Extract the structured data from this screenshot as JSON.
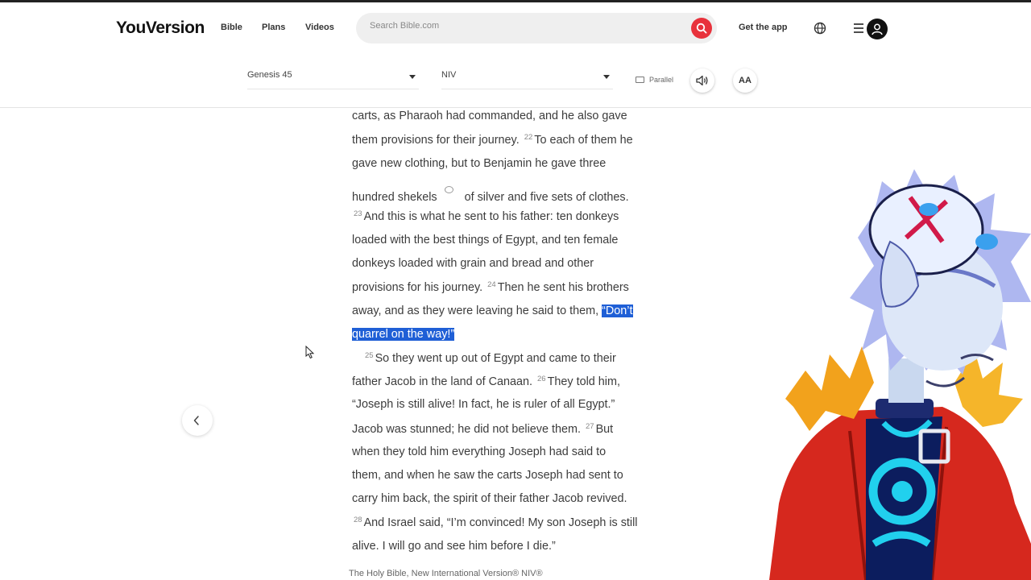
{
  "nav": {
    "logo": "YouVersion",
    "links": [
      "Bible",
      "Plans",
      "Videos"
    ],
    "search_placeholder": "Search Bible.com",
    "get_app": "Get the app"
  },
  "toolbar": {
    "book_select": "Genesis 45",
    "version_select": "NIV",
    "parallel": "Parallel",
    "font_button": "AA"
  },
  "passage": {
    "lines": [
      {
        "parts": [
          {
            "t": "carts, as Pharaoh had commanded, and he also gave"
          }
        ]
      },
      {
        "parts": [
          {
            "t": "them provisions for their journey. "
          },
          {
            "v": "22"
          },
          {
            "t": "To each of them he"
          }
        ]
      },
      {
        "parts": [
          {
            "t": "gave new clothing, but to Benjamin he gave three"
          }
        ]
      },
      {
        "parts": [
          {
            "t": "hundred shekels"
          },
          {
            "note": true
          },
          {
            "t": "of silver and five sets of clothes."
          }
        ]
      },
      {
        "parts": [
          {
            "v": "23"
          },
          {
            "t": "And this is what he sent to his father: ten donkeys"
          }
        ]
      },
      {
        "parts": [
          {
            "t": "loaded with the best things of Egypt, and ten female"
          }
        ]
      },
      {
        "parts": [
          {
            "t": "donkeys loaded with grain and bread and other"
          }
        ]
      },
      {
        "parts": [
          {
            "t": "provisions for his journey. "
          },
          {
            "v": "24"
          },
          {
            "t": "Then he sent his brothers"
          }
        ]
      },
      {
        "parts": [
          {
            "t": "away, and as they were leaving he said to them, "
          },
          {
            "h": "“Don’t"
          }
        ]
      },
      {
        "parts": [
          {
            "h": "quarrel on the way!”"
          }
        ]
      },
      {
        "indent": true,
        "parts": [
          {
            "v": "25"
          },
          {
            "t": "So they went up out of Egypt and came to their"
          }
        ]
      },
      {
        "parts": [
          {
            "t": "father Jacob in the land of Canaan. "
          },
          {
            "v": "26"
          },
          {
            "t": "They told him,"
          }
        ]
      },
      {
        "parts": [
          {
            "t": "“Joseph is still alive! In fact, he is ruler of all Egypt.”"
          }
        ]
      },
      {
        "parts": [
          {
            "t": "Jacob was stunned; he did not believe them. "
          },
          {
            "v": "27"
          },
          {
            "t": "But"
          }
        ]
      },
      {
        "parts": [
          {
            "t": "when they told him everything Joseph had said to"
          }
        ]
      },
      {
        "parts": [
          {
            "t": "them, and when he saw the carts Joseph had sent to"
          }
        ]
      },
      {
        "parts": [
          {
            "t": "carry him back, the spirit of their father Jacob revived."
          }
        ]
      },
      {
        "parts": [
          {
            "v": "28"
          },
          {
            "t": "And Israel said, “I’m convinced! My son Joseph is still"
          }
        ]
      },
      {
        "parts": [
          {
            "t": "alive. I will go and see him before I die.”"
          }
        ]
      }
    ],
    "copyright": "The Holy Bible, New International Version® NIV®"
  },
  "colors": {
    "accent": "#e8323c",
    "highlight": "#1f5fd6"
  },
  "icons": [
    "search-icon",
    "globe-icon",
    "menu-icon",
    "user-icon",
    "parallel-icon",
    "audio-icon",
    "note-icon",
    "chevron-left-icon",
    "mouse-cursor-icon"
  ]
}
